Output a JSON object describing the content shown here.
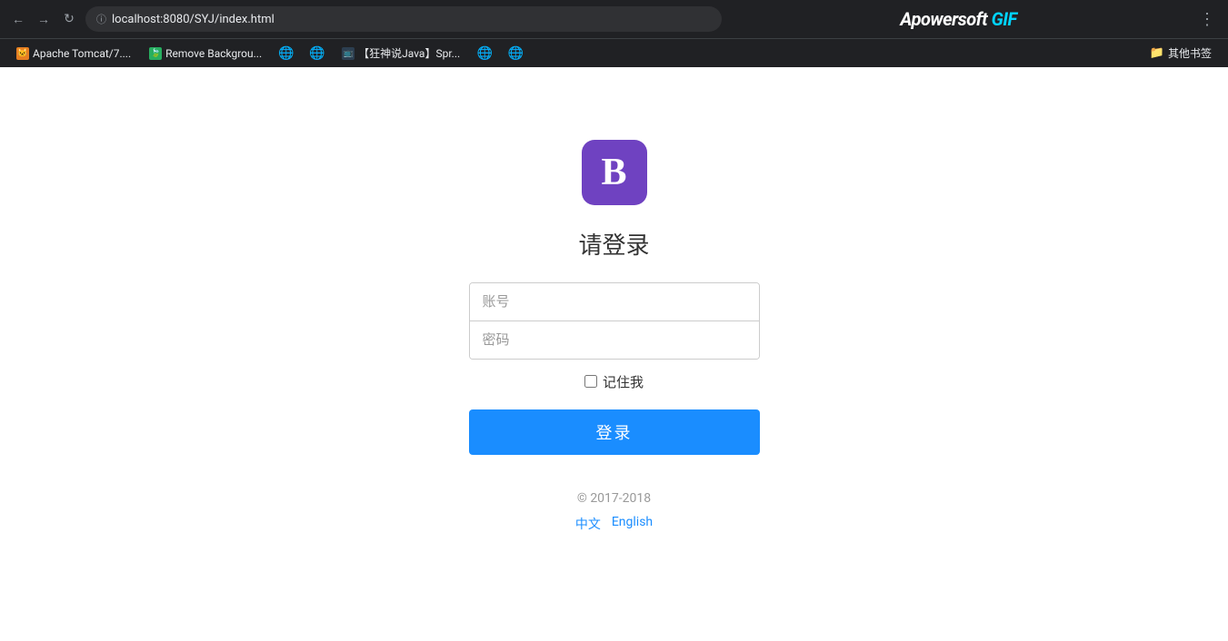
{
  "browser": {
    "url": "localhost:8080/SYJ/index.html",
    "nav": {
      "back_label": "←",
      "forward_label": "→",
      "refresh_label": "↻"
    },
    "bookmarks": [
      {
        "label": "Apache Tomcat/7....",
        "icon_type": "tomcat"
      },
      {
        "label": "Remove Backgrou...",
        "icon_type": "leaf"
      },
      {
        "label": "",
        "icon_type": "globe"
      },
      {
        "label": "",
        "icon_type": "globe"
      },
      {
        "label": "【狂神说Java】Spr...",
        "icon_type": "tv"
      },
      {
        "label": "",
        "icon_type": "globe"
      },
      {
        "label": "",
        "icon_type": "globe"
      }
    ],
    "other_bookmarks": "其他书签",
    "apowersoft_label": "Apowersoft GIF",
    "menu_label": "⋮"
  },
  "page": {
    "logo_letter": "B",
    "title": "请登录",
    "form": {
      "username_placeholder": "账号",
      "password_placeholder": "密码"
    },
    "remember_me_label": "记住我",
    "login_button_label": "登录",
    "footer": {
      "copyright": "© 2017-2018",
      "lang_chinese": "中文",
      "lang_english": "English"
    }
  }
}
